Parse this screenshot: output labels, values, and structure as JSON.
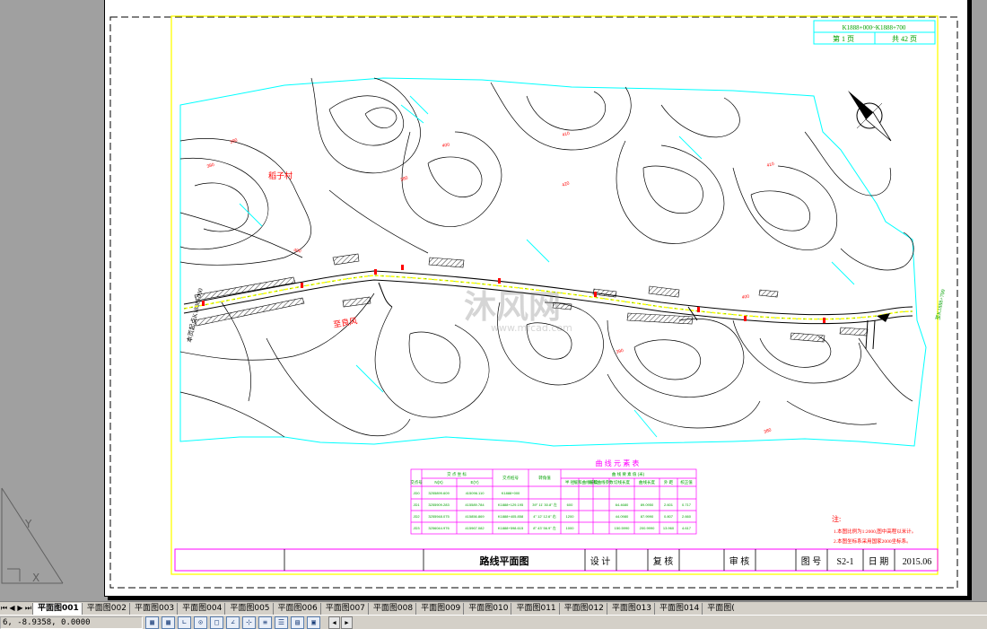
{
  "drawing": {
    "stake_range": "K1888+000~K1888+700",
    "page_label": "第 1 页",
    "page_total": "共 42 页",
    "village_name": "稻子村",
    "road_label": "至良风",
    "start_note": "本页起点K1888+000",
    "end_note": "至K1888+700",
    "contour_labels": [
      "380",
      "390",
      "400",
      "380",
      "400",
      "410",
      "420",
      "410",
      "400",
      "390",
      "380"
    ],
    "watermark": "沐风网",
    "watermark_url": "www.mfcad.com"
  },
  "curve_table": {
    "title": "曲 线 元 素 表",
    "group_headers": [
      "交 点 坐 标",
      "交点桩号",
      "转角值",
      "曲 线 要 素 值 (米)"
    ],
    "columns": [
      "交点号",
      "N(X)",
      "E(Y)",
      "交点桩号",
      "转角值",
      "半 径",
      "缓和曲线长度",
      "缓和曲线参数",
      "切线长度",
      "曲线长度",
      "外 距",
      "校正值"
    ],
    "rows": [
      [
        "JD0",
        "3255899.609",
        "415096.110",
        "K1888+000",
        "",
        "",
        "",
        "",
        "",
        "",
        "",
        ""
      ],
      [
        "JD1",
        "3255909.283",
        "415589.784",
        "K1888+129.195",
        "39° 11' 30.8\" 左",
        "600",
        "",
        "",
        "64.4680",
        "89.0950",
        "2.601",
        "0.717"
      ],
      [
        "JD2",
        "3255948.075",
        "415856.869",
        "K1888+405.858",
        "4° 12' 12.6\" 右",
        "1200",
        "",
        "",
        "44.0980",
        "87.9990",
        "0.807",
        "2.660"
      ],
      [
        "JD3",
        "3256044.976",
        "415967.082",
        "K1888+598.615",
        "8° 43' 56.9\" 左",
        "1000",
        "",
        "",
        "150.5990",
        "200.9990",
        "13.960",
        "4.617"
      ]
    ]
  },
  "notes": {
    "title": "注:",
    "lines": [
      "1.本图比例为1:2000,图中高程以米计。",
      "2.本图坐标系采用国家2000坐标系。"
    ]
  },
  "title_block": {
    "drawing_title": "路线平面图",
    "design_label": "设 计",
    "review_label": "复 核",
    "approve_label": "审 核",
    "drawing_no_label": "图 号",
    "drawing_no": "S2-1",
    "date_label": "日 期",
    "date": "2015.06"
  },
  "layout_tabs": {
    "nav": [
      "⏮",
      "◀",
      "▶",
      "⏭"
    ],
    "tabs": [
      "平面图001",
      "平面图002",
      "平面图003",
      "平面图004",
      "平面图005",
      "平面图006",
      "平面图007",
      "平面图008",
      "平面图009",
      "平面图010",
      "平面图011",
      "平面图012",
      "平面图013",
      "平面图014",
      "平面图("
    ],
    "active_index": 0
  },
  "status_bar": {
    "coordinates": "6, -8.9358, 0.0000",
    "icons": [
      "snap-icon",
      "grid-icon",
      "ortho-icon",
      "polar-icon",
      "osnap-icon",
      "otrack-icon",
      "ducs-icon",
      "dyn-icon",
      "lineweight-icon",
      "model-icon",
      "qp-icon"
    ],
    "icon_glyphs": [
      "▦",
      "▦",
      "∟",
      "⊙",
      "□",
      "∠",
      "⊹",
      "≡",
      "☰",
      "▤",
      "▣"
    ]
  },
  "colors": {
    "background": "#a0a0a0",
    "paper": "#ffffff",
    "frame_yellow": "#ffff00",
    "table_magenta": "#ff00ff",
    "boundary_cyan": "#00ffff",
    "road_red": "#ff0000",
    "contour": "#000000",
    "header_text_green": "#00a000"
  }
}
